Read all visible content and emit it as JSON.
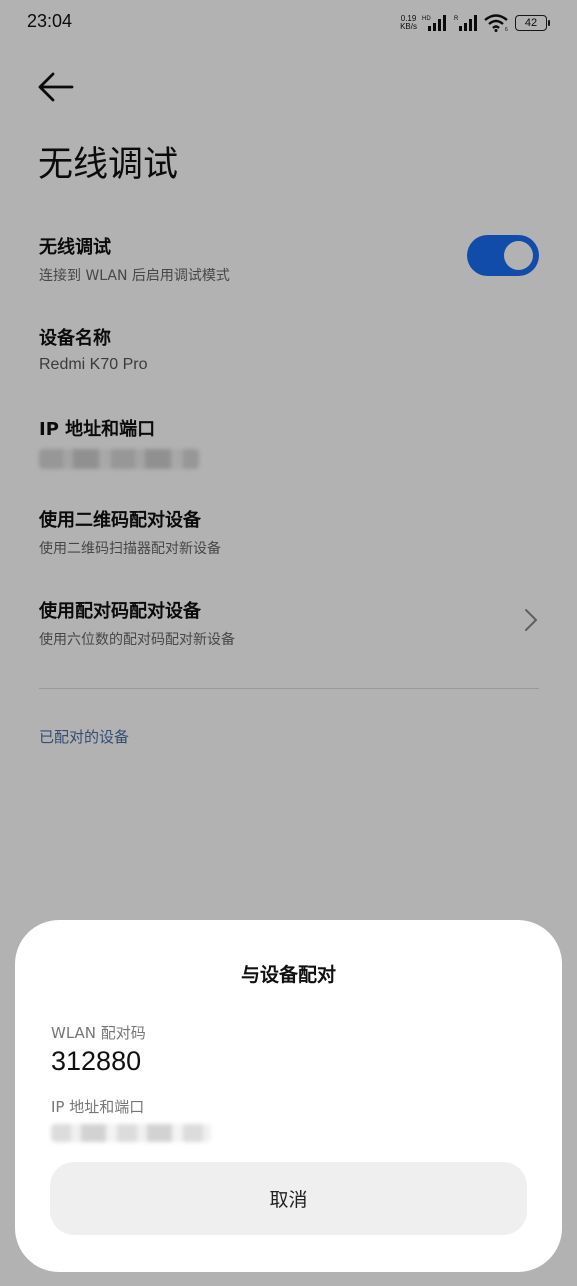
{
  "status_bar": {
    "time": "23:04",
    "net_speed_value": "0.19",
    "net_speed_unit": "KB/s",
    "sim1_tag": "HD",
    "sim2_tag": "R",
    "wifi_tag": "6",
    "battery": "42"
  },
  "header": {
    "title": "无线调试"
  },
  "settings": {
    "wireless_debugging": {
      "label": "无线调试",
      "sub": "连接到 WLAN 后启用调试模式",
      "enabled": true
    },
    "device_name": {
      "label": "设备名称",
      "value": "Redmi K70 Pro"
    },
    "ip_port": {
      "label": "IP 地址和端口"
    },
    "qr_pair": {
      "label": "使用二维码配对设备",
      "sub": "使用二维码扫描器配对新设备"
    },
    "code_pair": {
      "label": "使用配对码配对设备",
      "sub": "使用六位数的配对码配对新设备"
    },
    "paired_section": "已配对的设备"
  },
  "dialog": {
    "title": "与设备配对",
    "wlan_code_label": "WLAN 配对码",
    "wlan_code": "312880",
    "ip_label": "IP 地址和端口",
    "cancel_label": "取消"
  },
  "colors": {
    "accent": "#1a6ef5",
    "section": "#4a6fa5",
    "scrim": "rgba(0,0,0,0.30)"
  }
}
